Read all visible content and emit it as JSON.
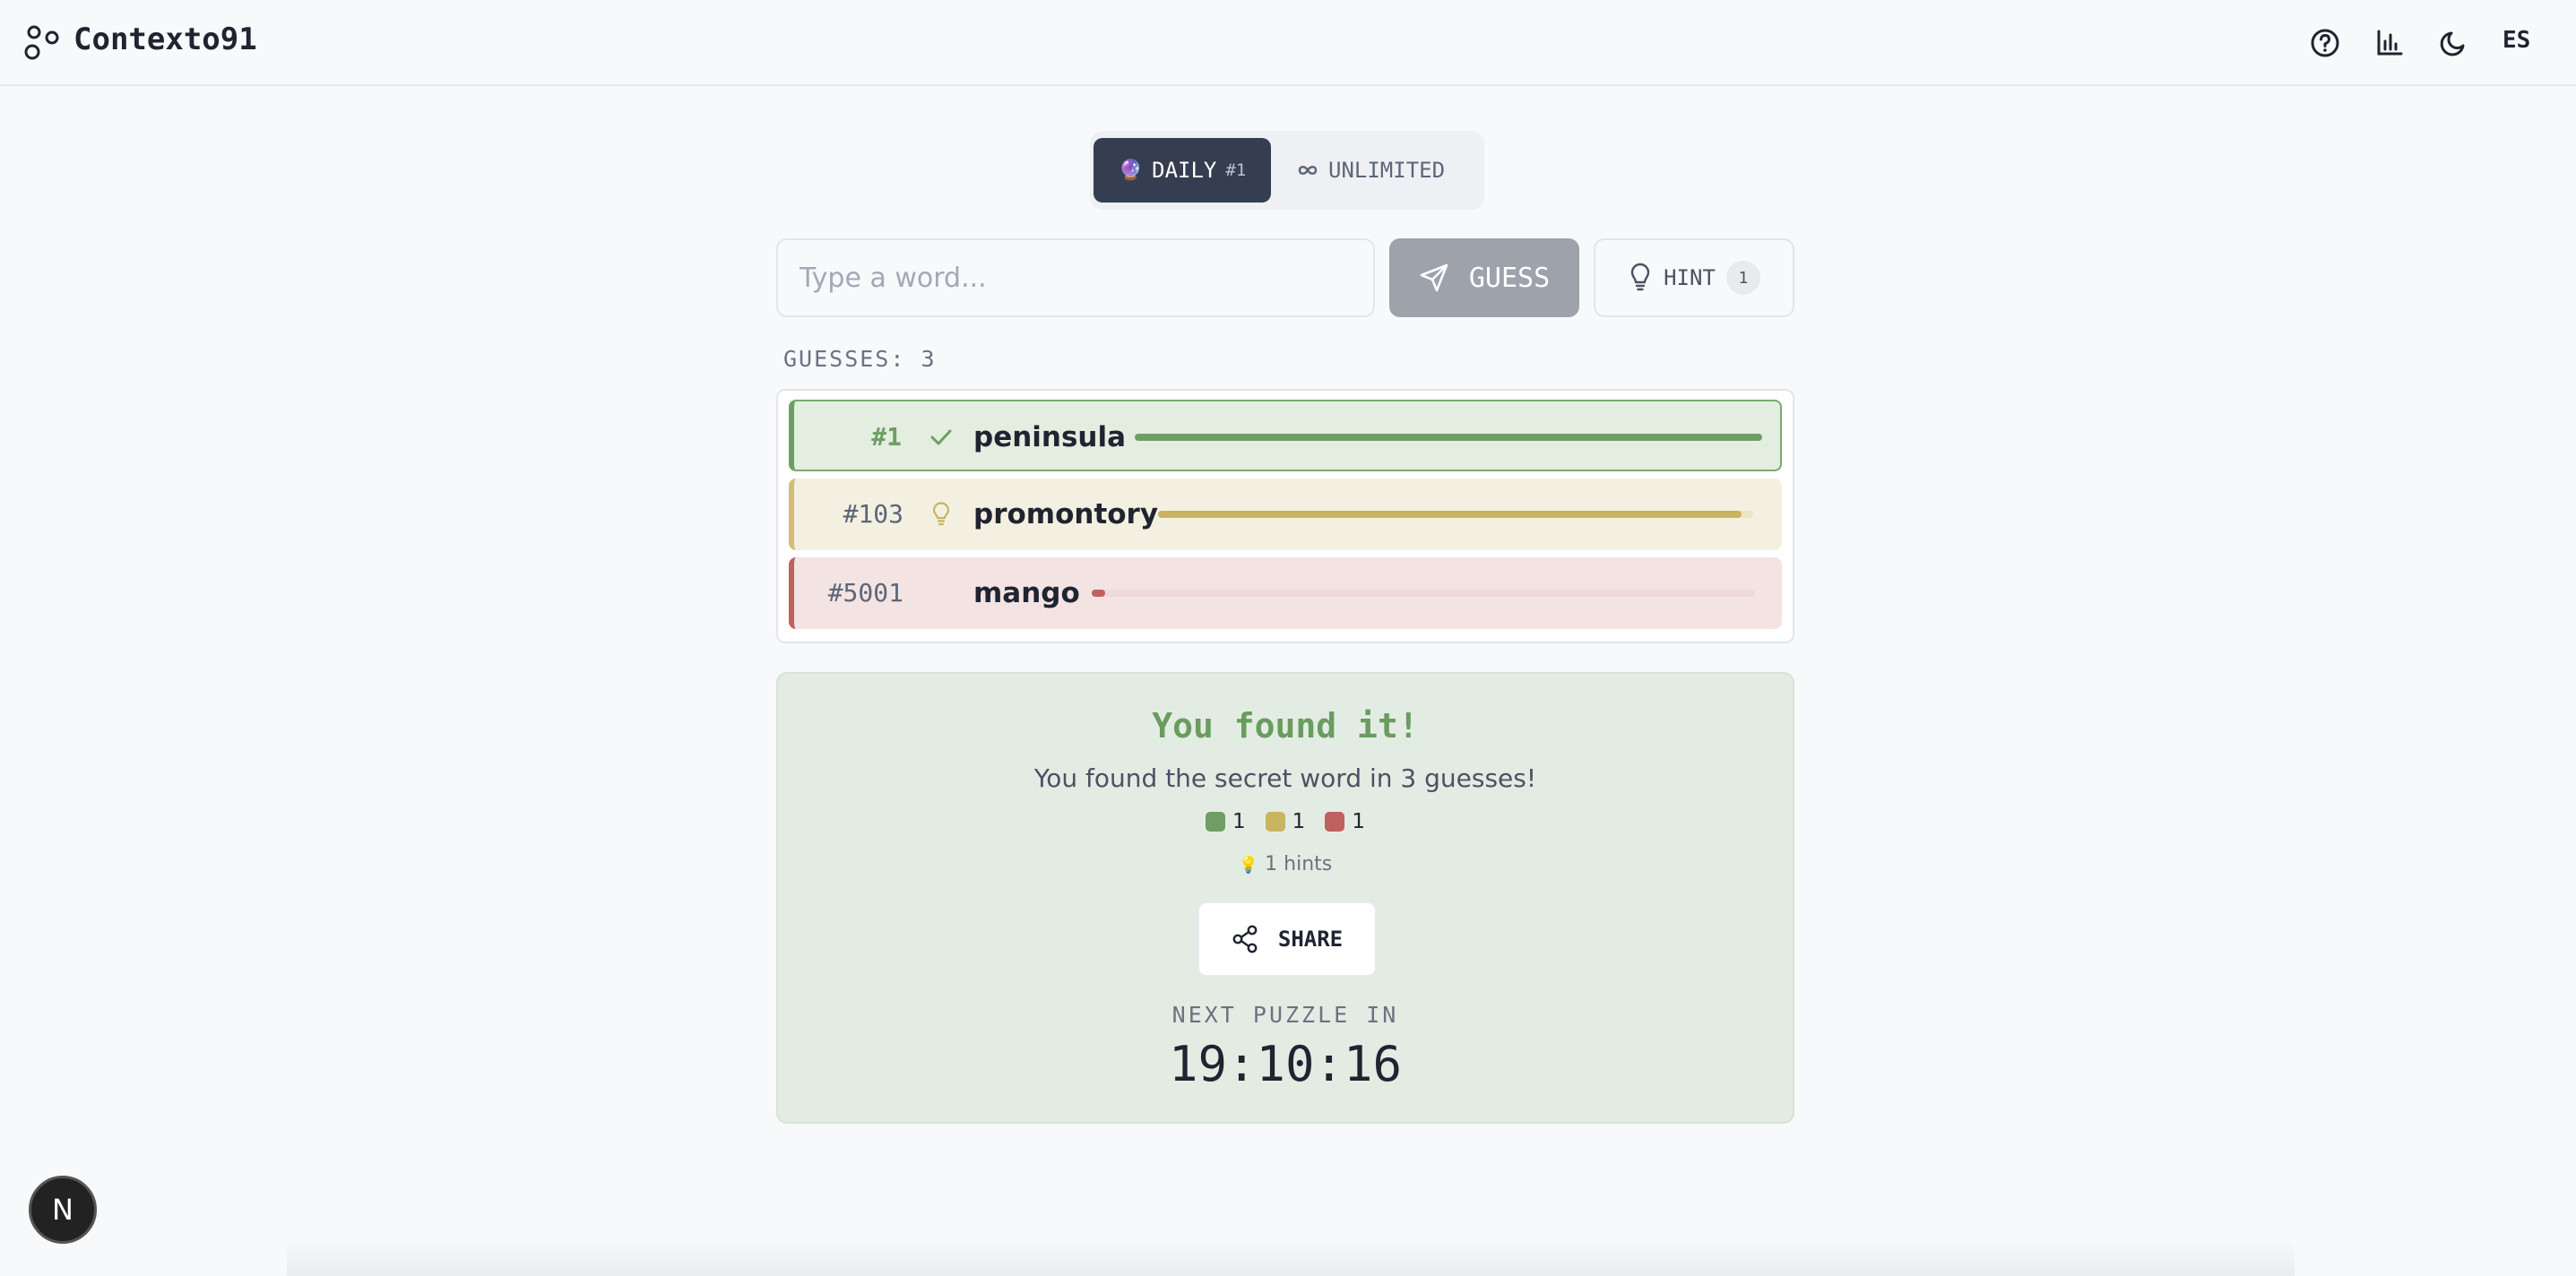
{
  "header": {
    "brand": "Contexto91",
    "lang": "ES",
    "icons": [
      "logo-icon",
      "help-icon",
      "stats-icon",
      "moon-icon"
    ]
  },
  "modes": {
    "daily_emoji": "🔮",
    "daily_label": "DAILY",
    "daily_number": "#1",
    "unlimited_label": "UNLIMITED"
  },
  "input": {
    "placeholder": "Type a word..."
  },
  "guess_button": {
    "label": "GUESS"
  },
  "hint_button": {
    "label": "HINT",
    "count": "1"
  },
  "guesses_label": "GUESSES: 3",
  "guesses": [
    {
      "rank": "#1",
      "word": "peninsula",
      "status": "correct",
      "color": "#6f9e63",
      "closeness": 1.0
    },
    {
      "rank": "#103",
      "word": "promontory",
      "status": "hint",
      "color": "#c9b45f",
      "closeness": 0.98
    },
    {
      "rank": "#5001",
      "word": "mango",
      "status": "far",
      "color": "#c0605f",
      "closeness": 0.02
    }
  ],
  "result": {
    "title": "You found it!",
    "subtitle": "You found the secret word in 3 guesses!",
    "counts": [
      {
        "color": "#6f9e63",
        "value": "1"
      },
      {
        "color": "#c9b45f",
        "value": "1"
      },
      {
        "color": "#c0605f",
        "value": "1"
      }
    ],
    "hints_emoji": "💡",
    "hints_text": "1 hints",
    "share_label": "SHARE",
    "next_label": "NEXT PUZZLE IN",
    "timer": "19:10:16"
  },
  "badge": "N",
  "colors": {
    "accent": "#353e50",
    "green": "#6f9e63",
    "yellow": "#c9b45f",
    "red": "#c0605f"
  }
}
